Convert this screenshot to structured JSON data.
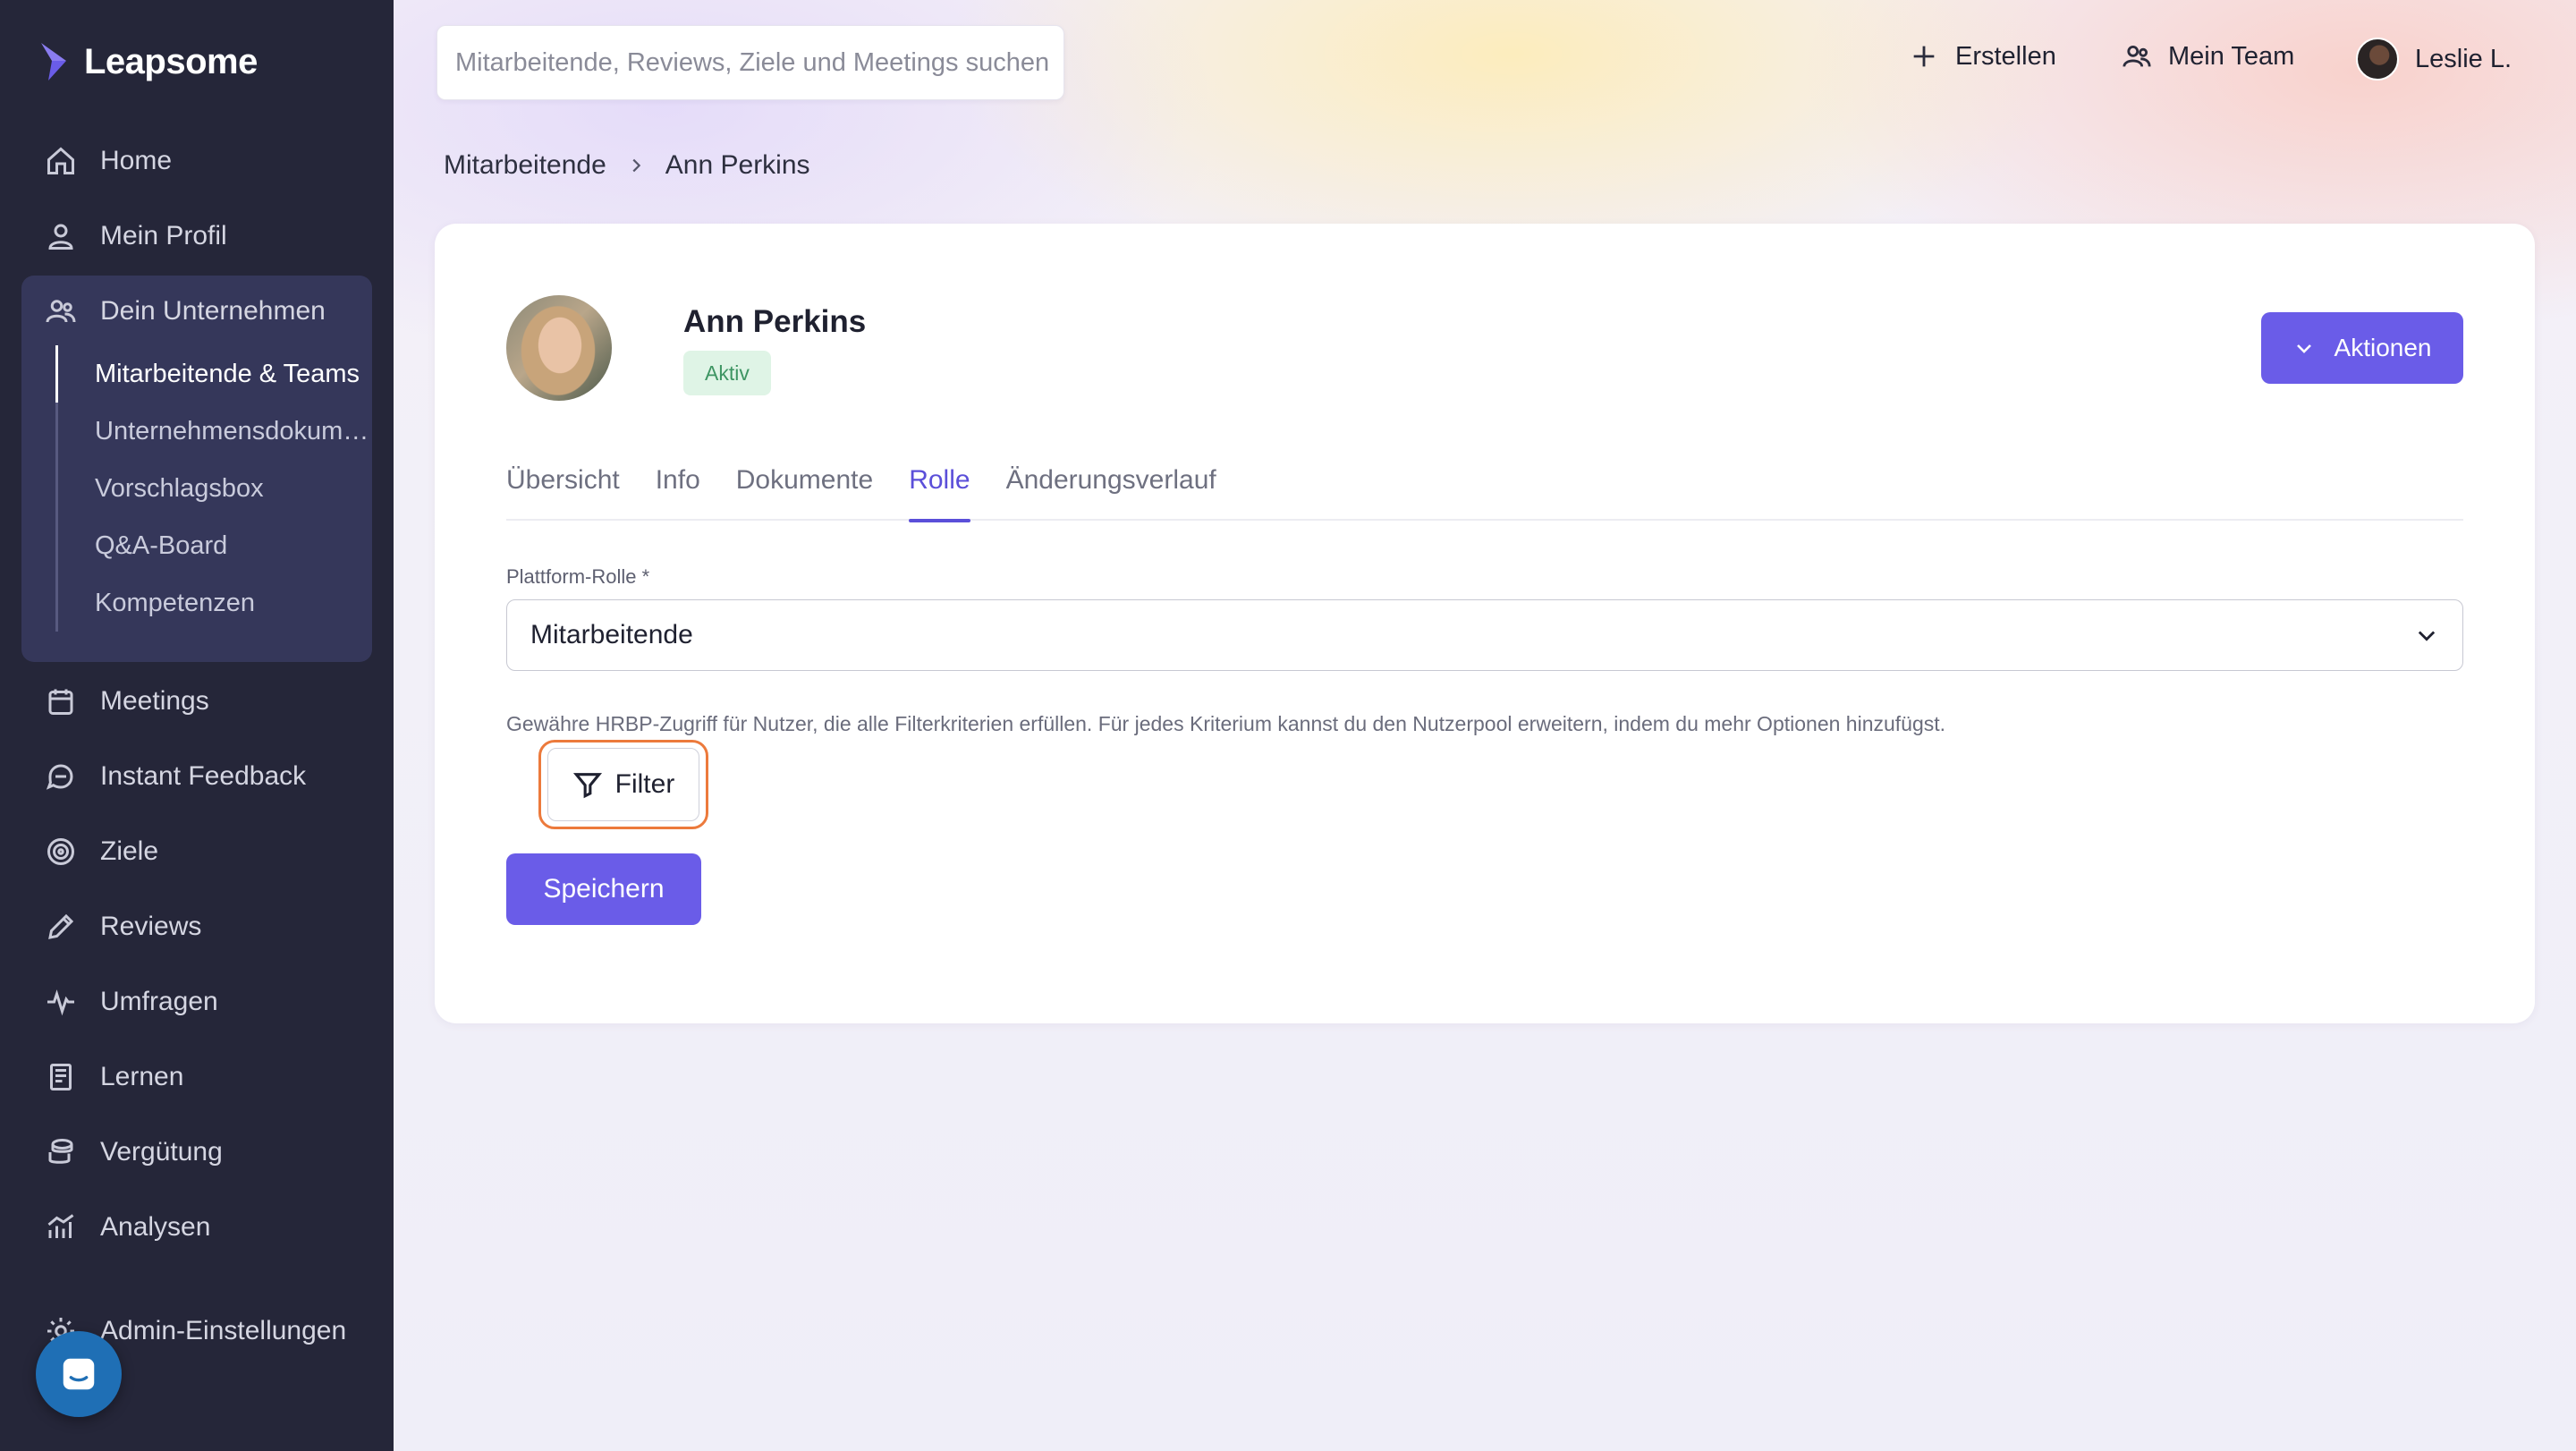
{
  "app": {
    "brand": "Leapsome"
  },
  "sidebar": {
    "items": [
      {
        "label": "Home",
        "icon": "home-icon"
      },
      {
        "label": "Mein Profil",
        "icon": "user-icon"
      },
      {
        "label": "Dein Unternehmen",
        "icon": "people-icon"
      },
      {
        "label": "Meetings",
        "icon": "calendar-icon"
      },
      {
        "label": "Instant Feedback",
        "icon": "chat-icon"
      },
      {
        "label": "Ziele",
        "icon": "target-icon"
      },
      {
        "label": "Reviews",
        "icon": "pencil-icon"
      },
      {
        "label": "Umfragen",
        "icon": "pulse-icon"
      },
      {
        "label": "Lernen",
        "icon": "book-icon"
      },
      {
        "label": "Vergütung",
        "icon": "coins-icon"
      },
      {
        "label": "Analysen",
        "icon": "chart-icon"
      },
      {
        "label": "Admin-Einstellungen",
        "icon": "gear-icon"
      }
    ],
    "subitems": [
      {
        "label": "Mitarbeitende & Teams",
        "active": true
      },
      {
        "label": "Unternehmensdokumente"
      },
      {
        "label": "Vorschlagsbox"
      },
      {
        "label": "Q&A-Board"
      },
      {
        "label": "Kompetenzen"
      }
    ]
  },
  "topbar": {
    "search_placeholder": "Mitarbeitende, Reviews, Ziele und Meetings suchen",
    "create_label": "Erstellen",
    "team_label": "Mein Team",
    "user_label": "Leslie L."
  },
  "breadcrumb": {
    "parent": "Mitarbeitende",
    "current": "Ann Perkins"
  },
  "profile": {
    "name": "Ann Perkins",
    "status": "Aktiv",
    "actions_label": "Aktionen"
  },
  "tabs": [
    {
      "label": "Übersicht"
    },
    {
      "label": "Info"
    },
    {
      "label": "Dokumente"
    },
    {
      "label": "Rolle",
      "active": true
    },
    {
      "label": "Änderungsverlauf"
    }
  ],
  "role_form": {
    "field_label": "Plattform-Rolle *",
    "selected_value": "Mitarbeitende",
    "help_text": "Gewähre HRBP-Zugriff für Nutzer, die alle Filterkriterien erfüllen. Für jedes Kriterium kannst du den Nutzerpool erweitern, indem du mehr Optionen hinzufügst.",
    "filter_label": "Filter",
    "save_label": "Speichern"
  },
  "colors": {
    "sidebar_bg": "#252639",
    "accent": "#6a5ce8",
    "focus_ring": "#ec7a3c",
    "status_bg": "#dff4e6",
    "status_text": "#3e9563"
  }
}
